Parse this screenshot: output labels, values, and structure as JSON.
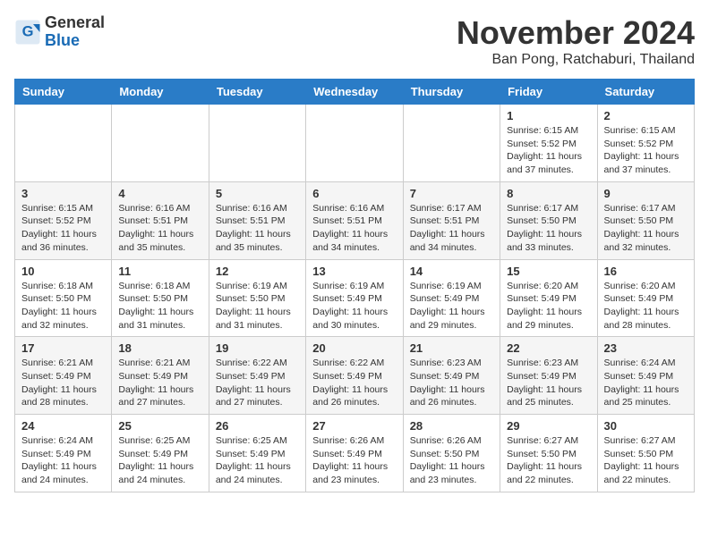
{
  "header": {
    "logo_line1": "General",
    "logo_line2": "Blue",
    "month": "November 2024",
    "location": "Ban Pong, Ratchaburi, Thailand"
  },
  "weekdays": [
    "Sunday",
    "Monday",
    "Tuesday",
    "Wednesday",
    "Thursday",
    "Friday",
    "Saturday"
  ],
  "weeks": [
    [
      {
        "day": "",
        "info": ""
      },
      {
        "day": "",
        "info": ""
      },
      {
        "day": "",
        "info": ""
      },
      {
        "day": "",
        "info": ""
      },
      {
        "day": "",
        "info": ""
      },
      {
        "day": "1",
        "info": "Sunrise: 6:15 AM\nSunset: 5:52 PM\nDaylight: 11 hours and 37 minutes."
      },
      {
        "day": "2",
        "info": "Sunrise: 6:15 AM\nSunset: 5:52 PM\nDaylight: 11 hours and 37 minutes."
      }
    ],
    [
      {
        "day": "3",
        "info": "Sunrise: 6:15 AM\nSunset: 5:52 PM\nDaylight: 11 hours and 36 minutes."
      },
      {
        "day": "4",
        "info": "Sunrise: 6:16 AM\nSunset: 5:51 PM\nDaylight: 11 hours and 35 minutes."
      },
      {
        "day": "5",
        "info": "Sunrise: 6:16 AM\nSunset: 5:51 PM\nDaylight: 11 hours and 35 minutes."
      },
      {
        "day": "6",
        "info": "Sunrise: 6:16 AM\nSunset: 5:51 PM\nDaylight: 11 hours and 34 minutes."
      },
      {
        "day": "7",
        "info": "Sunrise: 6:17 AM\nSunset: 5:51 PM\nDaylight: 11 hours and 34 minutes."
      },
      {
        "day": "8",
        "info": "Sunrise: 6:17 AM\nSunset: 5:50 PM\nDaylight: 11 hours and 33 minutes."
      },
      {
        "day": "9",
        "info": "Sunrise: 6:17 AM\nSunset: 5:50 PM\nDaylight: 11 hours and 32 minutes."
      }
    ],
    [
      {
        "day": "10",
        "info": "Sunrise: 6:18 AM\nSunset: 5:50 PM\nDaylight: 11 hours and 32 minutes."
      },
      {
        "day": "11",
        "info": "Sunrise: 6:18 AM\nSunset: 5:50 PM\nDaylight: 11 hours and 31 minutes."
      },
      {
        "day": "12",
        "info": "Sunrise: 6:19 AM\nSunset: 5:50 PM\nDaylight: 11 hours and 31 minutes."
      },
      {
        "day": "13",
        "info": "Sunrise: 6:19 AM\nSunset: 5:49 PM\nDaylight: 11 hours and 30 minutes."
      },
      {
        "day": "14",
        "info": "Sunrise: 6:19 AM\nSunset: 5:49 PM\nDaylight: 11 hours and 29 minutes."
      },
      {
        "day": "15",
        "info": "Sunrise: 6:20 AM\nSunset: 5:49 PM\nDaylight: 11 hours and 29 minutes."
      },
      {
        "day": "16",
        "info": "Sunrise: 6:20 AM\nSunset: 5:49 PM\nDaylight: 11 hours and 28 minutes."
      }
    ],
    [
      {
        "day": "17",
        "info": "Sunrise: 6:21 AM\nSunset: 5:49 PM\nDaylight: 11 hours and 28 minutes."
      },
      {
        "day": "18",
        "info": "Sunrise: 6:21 AM\nSunset: 5:49 PM\nDaylight: 11 hours and 27 minutes."
      },
      {
        "day": "19",
        "info": "Sunrise: 6:22 AM\nSunset: 5:49 PM\nDaylight: 11 hours and 27 minutes."
      },
      {
        "day": "20",
        "info": "Sunrise: 6:22 AM\nSunset: 5:49 PM\nDaylight: 11 hours and 26 minutes."
      },
      {
        "day": "21",
        "info": "Sunrise: 6:23 AM\nSunset: 5:49 PM\nDaylight: 11 hours and 26 minutes."
      },
      {
        "day": "22",
        "info": "Sunrise: 6:23 AM\nSunset: 5:49 PM\nDaylight: 11 hours and 25 minutes."
      },
      {
        "day": "23",
        "info": "Sunrise: 6:24 AM\nSunset: 5:49 PM\nDaylight: 11 hours and 25 minutes."
      }
    ],
    [
      {
        "day": "24",
        "info": "Sunrise: 6:24 AM\nSunset: 5:49 PM\nDaylight: 11 hours and 24 minutes."
      },
      {
        "day": "25",
        "info": "Sunrise: 6:25 AM\nSunset: 5:49 PM\nDaylight: 11 hours and 24 minutes."
      },
      {
        "day": "26",
        "info": "Sunrise: 6:25 AM\nSunset: 5:49 PM\nDaylight: 11 hours and 24 minutes."
      },
      {
        "day": "27",
        "info": "Sunrise: 6:26 AM\nSunset: 5:49 PM\nDaylight: 11 hours and 23 minutes."
      },
      {
        "day": "28",
        "info": "Sunrise: 6:26 AM\nSunset: 5:50 PM\nDaylight: 11 hours and 23 minutes."
      },
      {
        "day": "29",
        "info": "Sunrise: 6:27 AM\nSunset: 5:50 PM\nDaylight: 11 hours and 22 minutes."
      },
      {
        "day": "30",
        "info": "Sunrise: 6:27 AM\nSunset: 5:50 PM\nDaylight: 11 hours and 22 minutes."
      }
    ]
  ]
}
